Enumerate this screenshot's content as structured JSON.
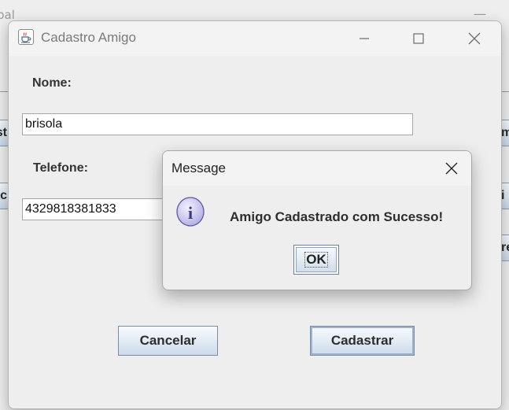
{
  "background_window": {
    "title_fragment": "pal",
    "minimize_glyph": "—",
    "left_buttons": [
      "st",
      "uc"
    ],
    "right_buttons": [
      "m",
      "i",
      "re"
    ]
  },
  "cadastro_window": {
    "title": "Cadastro Amigo",
    "icon": "java-coffee-icon",
    "controls": [
      "minimize-icon",
      "maximize-icon",
      "close-icon"
    ],
    "fields": {
      "nome": {
        "label": "Nome:",
        "value": "brisola"
      },
      "telefone": {
        "label": "Telefone:",
        "value": "4329818381833"
      }
    },
    "buttons": {
      "cancel": "Cancelar",
      "submit": "Cadastrar"
    }
  },
  "message_dialog": {
    "title": "Message",
    "icon": "information-icon",
    "icon_glyph": "i",
    "text": "Amigo Cadastrado com Sucesso!",
    "ok_label": "OK"
  },
  "colors": {
    "window_bg": "#eeeeee",
    "button_gradient_top": "#f8fbfe",
    "button_gradient_bottom": "#cddbea",
    "button_border": "#7a8da3",
    "info_icon_fill": "#c9c6ef",
    "info_icon_stroke": "#5c5a9c"
  }
}
